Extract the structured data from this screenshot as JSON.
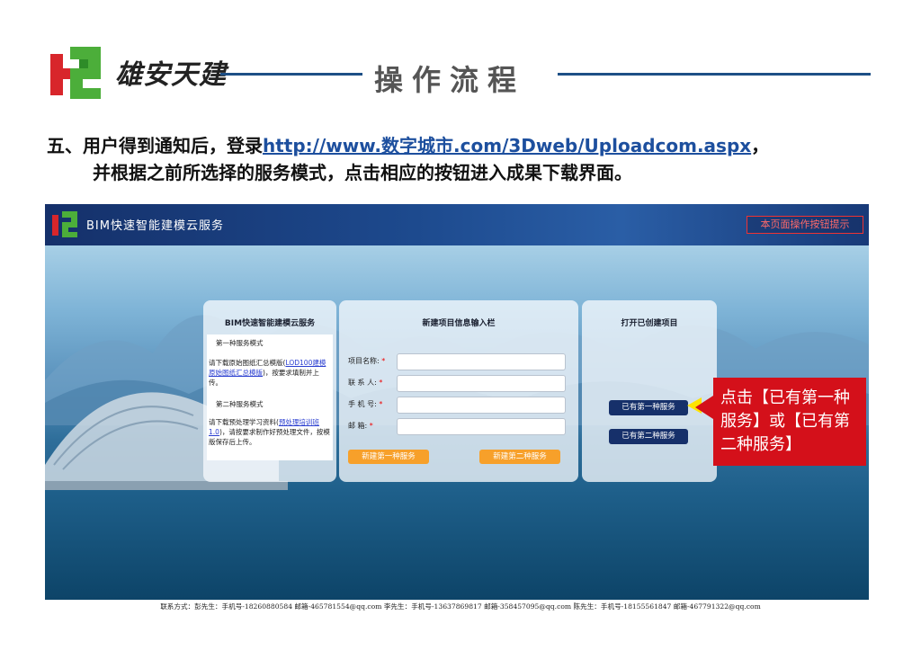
{
  "header": {
    "brand": "雄安天建",
    "title": "操作流程"
  },
  "instructions": {
    "line1_prefix": "五、用户得到通知后，登录",
    "line1_url": "http://www.数字城市.com/3Dweb/Uploadcom.aspx",
    "line1_suffix": "，",
    "line2": "并根据之前所选择的服务模式，点击相应的按钮进入成果下载界面。"
  },
  "app": {
    "title": "BIM快速智能建模云服务",
    "help_button": "本页面操作按钮提示",
    "panel1": {
      "heading": "BIM快速智能建模云服务",
      "mode1_title": "第一种服务模式",
      "mode1_text_a": "请下载原始图纸汇总模版(",
      "mode1_link": "LOD100建模原始图纸汇总模版",
      "mode1_text_b": ")，按要求填制并上传。",
      "mode2_title": "第二种服务模式",
      "mode2_text_a": "请下载预处理学习资料(",
      "mode2_link": "预处理培训班1.0",
      "mode2_text_b": ")，请按要求制作好预处理文件，按模版保存后上传。"
    },
    "panel2": {
      "heading": "新建项目信息输入栏",
      "fields": [
        {
          "label": "项目名称:",
          "value": ""
        },
        {
          "label": "联 系 人:",
          "value": ""
        },
        {
          "label": "手 机 号:",
          "value": ""
        },
        {
          "label": "邮    箱:",
          "value": ""
        }
      ],
      "required_mark": "*",
      "button1": "新建第一种服务",
      "button2": "新建第二种服务"
    },
    "panel3": {
      "heading": "打开已创建项目",
      "button1": "已有第一种服务",
      "button2": "已有第二种服务"
    }
  },
  "callout": {
    "text": "点击【已有第一种服务】或【已有第二种服务】"
  },
  "footer": {
    "contact": "联系方式：彭先生：手机号-18260880584 邮箱-465781554@qq.com  李先生：手机号-13637869817 邮箱-358457095@qq.com  陈先生：手机号-18155561847 邮箱-467791322@qq.com"
  },
  "colors": {
    "accent_line": "#1d4f86",
    "callout": "#d4101a",
    "orange_button": "#f7a02a",
    "navy_button": "#16306a"
  }
}
